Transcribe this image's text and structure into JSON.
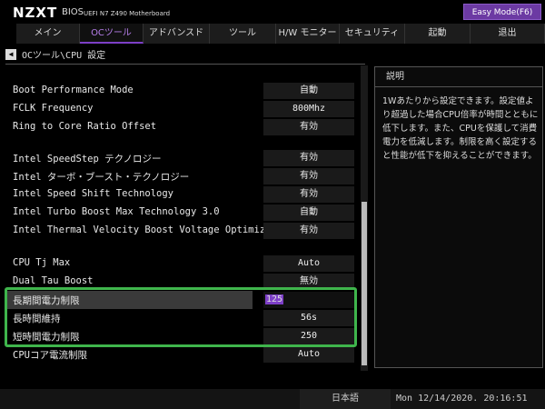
{
  "header": {
    "brand": "NZXT",
    "bios": "BIOS",
    "board": "UEFI  N7 Z490 Motherboard",
    "easy_mode": "Easy Mode(F6)"
  },
  "tabs": [
    {
      "label": "メイン"
    },
    {
      "label": "OCツール"
    },
    {
      "label": "アドバンスド"
    },
    {
      "label": "ツール"
    },
    {
      "label": "H/W モニター"
    },
    {
      "label": "セキュリティ"
    },
    {
      "label": "起動"
    },
    {
      "label": "退出"
    }
  ],
  "breadcrumb": "OCツール\\CPU 設定",
  "settings": [
    {
      "label": "Boot Performance Mode",
      "value": "自動"
    },
    {
      "label": "FCLK Frequency",
      "value": "800Mhz"
    },
    {
      "label": "Ring to Core Ratio Offset",
      "value": "有効"
    },
    {
      "label": "Intel SpeedStep テクノロジー",
      "value": "有効"
    },
    {
      "label": "Intel ターボ・ブースト・テクノロジー",
      "value": "有効"
    },
    {
      "label": "Intel Speed Shift Technology",
      "value": "有効"
    },
    {
      "label": "Intel Turbo Boost Max Technology 3.0",
      "value": "自動"
    },
    {
      "label": "Intel Thermal Velocity Boost Voltage Optimizations",
      "value": "有効"
    },
    {
      "label": "CPU Tj Max",
      "value": "Auto"
    },
    {
      "label": "Dual Tau Boost",
      "value": "無効"
    },
    {
      "label": "長期間電力制限",
      "value": "125"
    },
    {
      "label": "長時間維持",
      "value": "56s"
    },
    {
      "label": "短時間電力制限",
      "value": "250"
    },
    {
      "label": "CPUコア電流制限",
      "value": "Auto"
    }
  ],
  "help": {
    "title": "説明",
    "body": "1Wあたりから設定できます。設定値より超過した場合CPU倍率が時間とともに低下します。また、CPUを保護して消費電力を低減します。制限を高く設定すると性能が低下を抑えることができます。"
  },
  "footer": {
    "language": "日本語",
    "datetime": "Mon 12/14/2020. 20:16:51"
  },
  "colors": {
    "accent": "#7d3fc7",
    "highlight": "#3fb54c"
  }
}
